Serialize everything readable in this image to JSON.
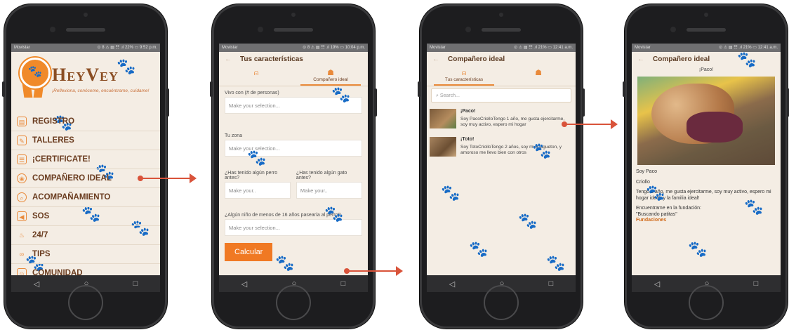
{
  "colors": {
    "accent": "#e98a3b",
    "brand": "#8a4d22",
    "arrow": "#d9533a",
    "button": "#f07923"
  },
  "screen1": {
    "carrier": "Movistar",
    "status_right": "⊙ 8 ⚠ ▤ ☷ .ıl 22% ▭ 9:52 p.m.",
    "brand": "HeyVey",
    "tagline": "¡Reflexiona, conóceme, encuéntrame, cuídame!",
    "menu": [
      {
        "label": "REGISTRO",
        "icon": "id-card-icon"
      },
      {
        "label": "TALLERES",
        "icon": "edit-icon"
      },
      {
        "label": "¡CERTIFICATE!",
        "icon": "certificate-icon"
      },
      {
        "label": "COMPAÑERO IDEAL",
        "icon": "paw-icon"
      },
      {
        "label": "ACOMPAÑAMIENTO",
        "icon": "search-icon"
      },
      {
        "label": "SOS",
        "icon": "megaphone-icon"
      },
      {
        "label": "24/7",
        "icon": "bowl-icon"
      },
      {
        "label": "TIPS",
        "icon": "tips-icon"
      },
      {
        "label": "COMUNIDAD",
        "icon": "community-icon"
      }
    ]
  },
  "screen2": {
    "carrier": "Movistar",
    "status_right": "⊙ 8 ⚠ ▤ ☷ .ıl 19% ▭ 10:04 p.m.",
    "title": "Tus características",
    "tab1": "",
    "tab2": "Compañero ideal",
    "field1_label": "Vivo con (# de personas)",
    "field1_placeholder": "Make your selection...",
    "field2_label": "Tu zona",
    "field2_placeholder": "Make your selection...",
    "field3_label": "¿Has tenido algún perro antes?",
    "field3_placeholder": "Make your..",
    "field4_label": "¿Has tenido algún gato antes?",
    "field4_placeholder": "Make your..",
    "field5_label": "¿Algún niño de menos  de 16 años pasearía al perro?",
    "field5_placeholder": "Make your selection...",
    "button": "Calcular"
  },
  "screen3": {
    "carrier": "Movistar",
    "status_right": "⊙ ⚠ ▤ ☷ .ıl 21% ▭ 12:41 a.m.",
    "title": "Compañero ideal",
    "tab1": "Tus características",
    "tab2": "",
    "search_placeholder": "Search...",
    "results": [
      {
        "name": "¡Paco!",
        "desc": "Soy PacoCriolloTengo 1 año, me gusta ejercitarme, soy muy activo, espero mi hogar"
      },
      {
        "name": "¡Toto!",
        "desc": "Soy TotoCriolloTengo 2 años, soy muy jugueton, y amoroso me llevo bien con otros"
      }
    ]
  },
  "screen4": {
    "carrier": "Movistar",
    "status_right": "⊙ ⚠ ▤ ☷ .ıl 21% ▭ 12:41 a.m.",
    "title": "Compañero ideal",
    "name_heading": "¡Paco!",
    "line1": "Soy Paco",
    "line2": "Criollo",
    "line3": "Tengo 1 año, me gusta ejercitarme, soy muy activo, espero mi hogar ideal, y la familia ideal!",
    "line4": "Encuentrame en la fundación:",
    "line5": "\"Buscando patitas\"",
    "link": "Fundaciones"
  }
}
